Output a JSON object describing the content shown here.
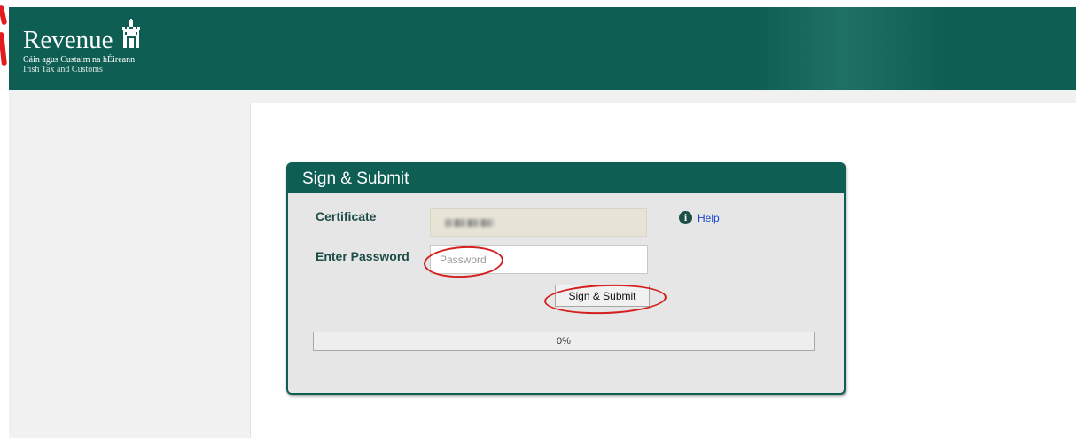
{
  "header": {
    "brand_name": "Revenue",
    "brand_line1": "Cáin agus Custaim na hÉireann",
    "brand_line2": "Irish Tax and Customs"
  },
  "dialog": {
    "title": "Sign & Submit",
    "certificate_label": "Certificate",
    "password_label": "Enter Password",
    "password_placeholder": "Password",
    "help_label": "Help",
    "submit_label": "Sign & Submit",
    "progress_text": "0%",
    "progress_value": 0
  },
  "colors": {
    "brand_green": "#0f5e54",
    "link_blue": "#1a45c8",
    "annotation_red": "#d41f1f"
  }
}
